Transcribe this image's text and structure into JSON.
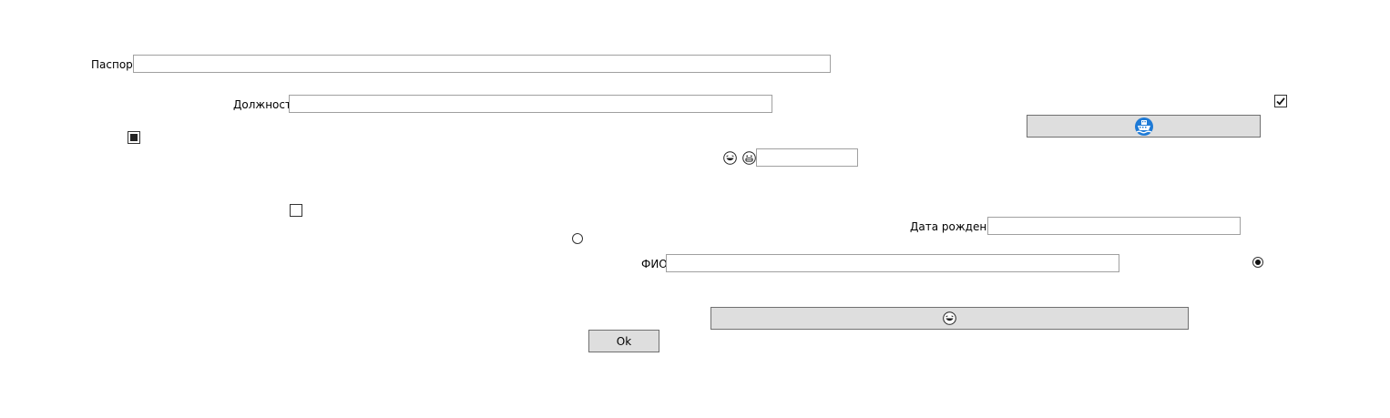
{
  "form": {
    "passport_label": "Паспорт",
    "passport_value": "",
    "position_label": "Должность",
    "position_value": "",
    "small_input_value": "",
    "birthdate_label": "Дата рождения",
    "birthdate_value": "",
    "fio_label": "ФИО",
    "fio_value": "",
    "ok_label": "Ok"
  },
  "controls": {
    "checkbox_top_right_checked": true,
    "checkbox_left_state": "indeterminate",
    "checkbox_middle_checked": false,
    "radio_middle_selected": false,
    "radio_right_selected": true
  },
  "icons": {
    "emoji_left": "laughing-face-icon",
    "emoji_right": "grinning-face-icon",
    "ship_button_icon": "ship-icon",
    "emoji_button_icon": "laughing-face-icon",
    "ship_icon_color": "#1e7ad6"
  },
  "colors": {
    "button_bg": "#dedede",
    "button_border": "#707070",
    "input_border": "#a0a0a0"
  }
}
